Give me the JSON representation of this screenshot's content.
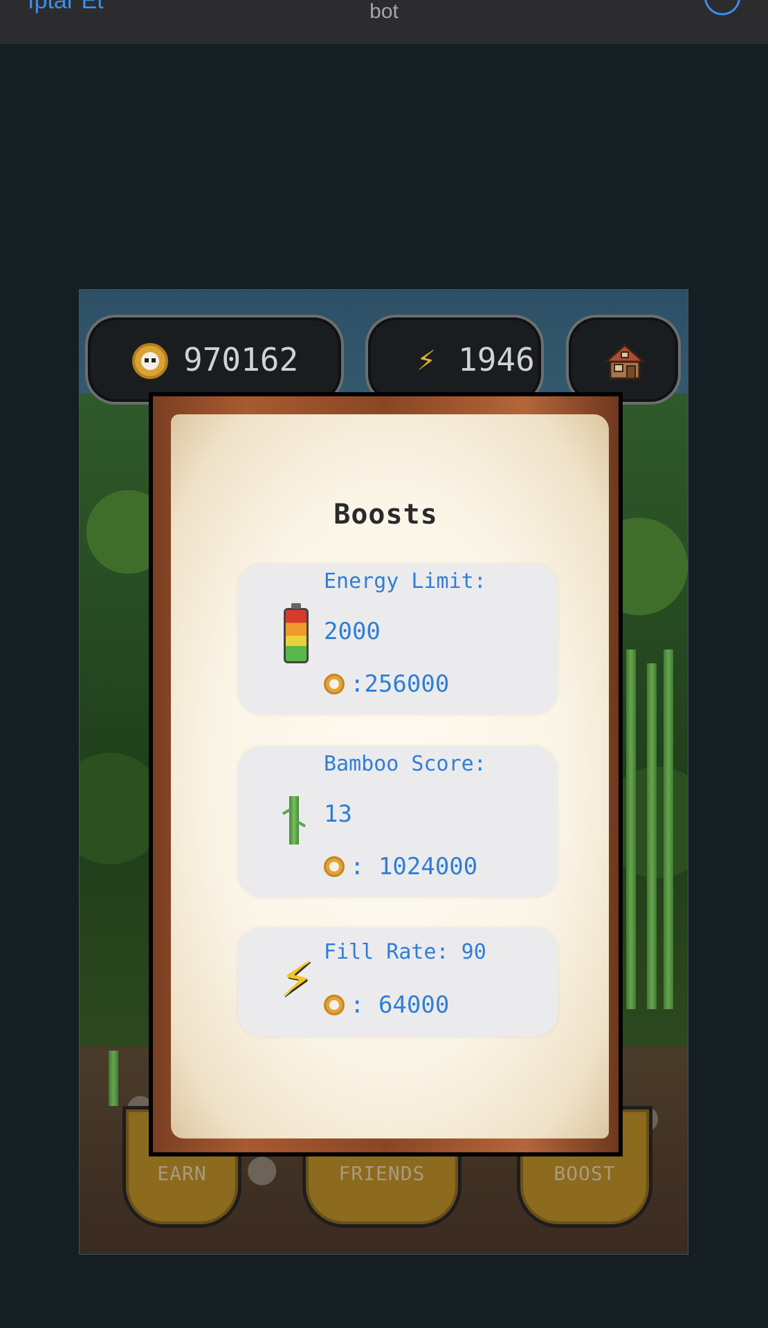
{
  "header": {
    "back_label": "Iptar Et",
    "title": "bot"
  },
  "stats": {
    "coins": "970162",
    "energy": "1946"
  },
  "modal": {
    "title": "Boosts",
    "cards": [
      {
        "label": "Energy Limit:",
        "value": "2000",
        "price": ":256000",
        "icon": "battery-icon"
      },
      {
        "label": "Bamboo Score:",
        "value": "13",
        "price": ": 1024000",
        "icon": "bamboo-icon"
      },
      {
        "label": "Fill Rate: 90",
        "price": ": 64000",
        "icon": "lightning-icon"
      }
    ]
  },
  "nav": {
    "earn": "EARN",
    "friends": "FRIENDS",
    "boost": "BOOST"
  },
  "colors": {
    "accent_blue": "#2f7ed6",
    "nav_gold": "#8c6a1e",
    "telegram_blue": "#3b8ff0"
  }
}
